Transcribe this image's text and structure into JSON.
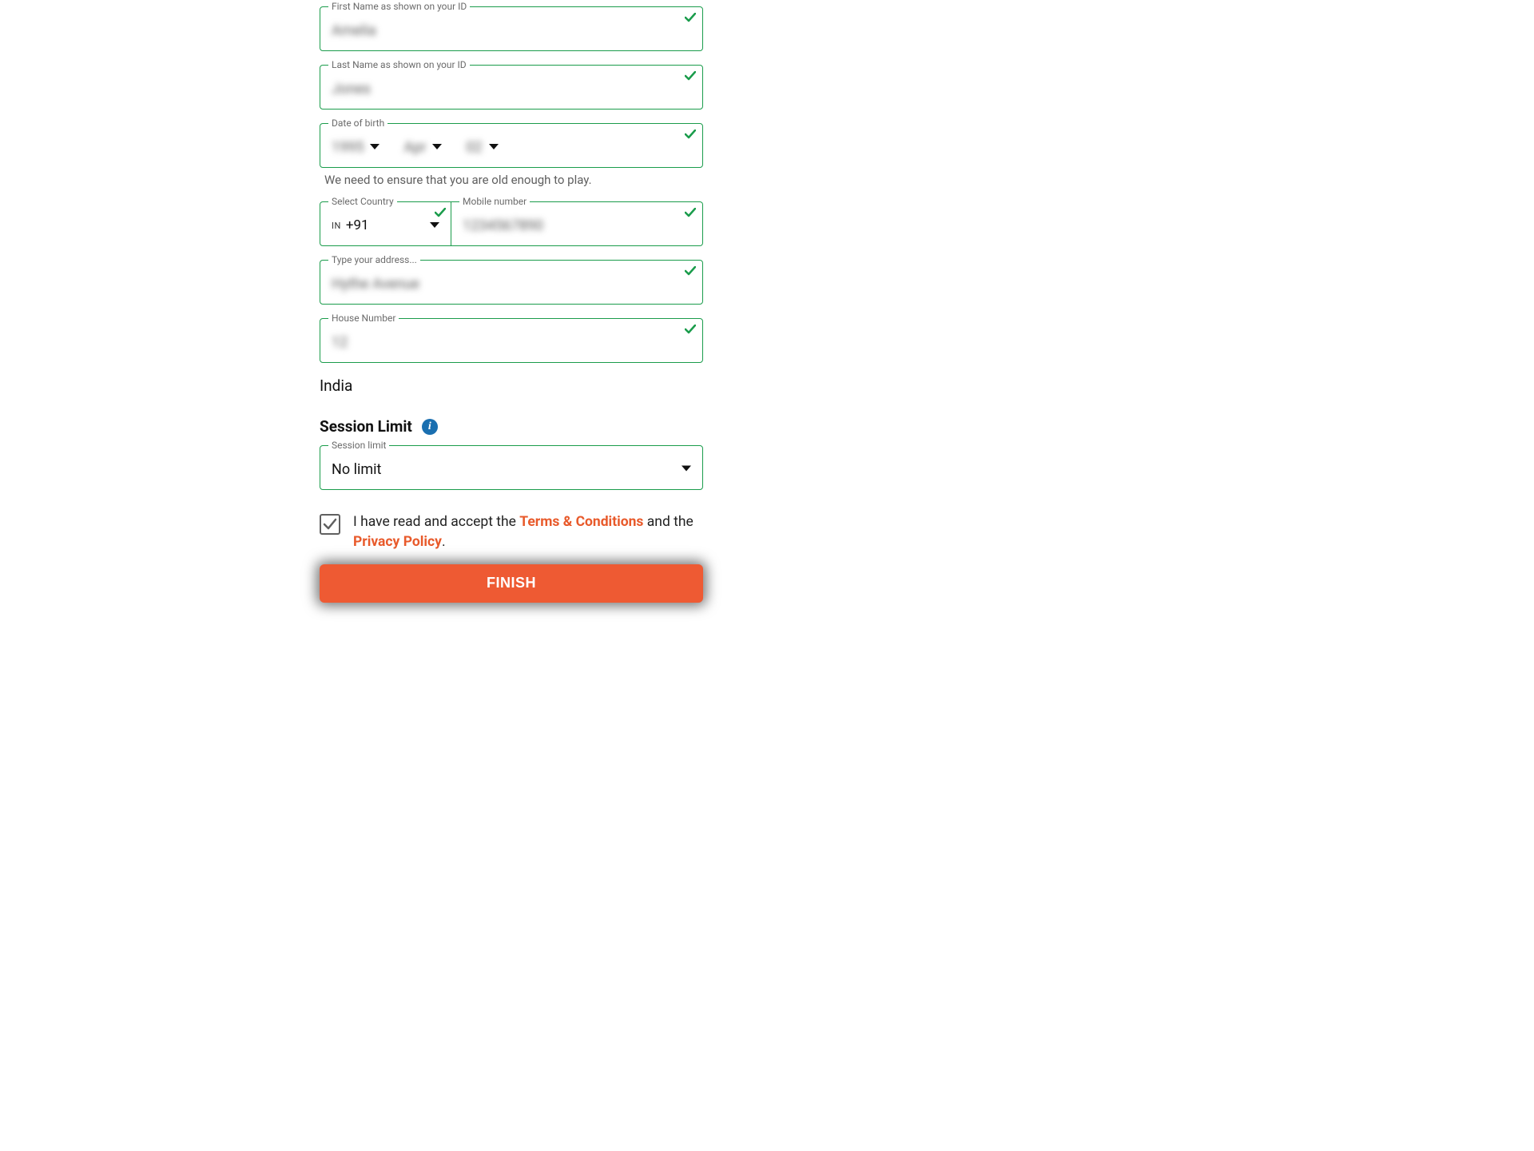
{
  "fields": {
    "first_name": {
      "label": "First Name as shown on your ID",
      "value": "Amelia"
    },
    "last_name": {
      "label": "Last Name as shown on your ID",
      "value": "Jones"
    },
    "dob": {
      "label": "Date of birth",
      "year": "1995",
      "month": "Apr",
      "day": "02",
      "hint": "We need to ensure that you are old enough to play."
    },
    "country": {
      "label": "Select Country",
      "code": "IN",
      "dial": "+91"
    },
    "mobile": {
      "label": "Mobile number",
      "value": "1234567890"
    },
    "address": {
      "label": "Type your address...",
      "value": "Hythe Avenue"
    },
    "house": {
      "label": "House Number",
      "value": "12"
    },
    "country_text": "India"
  },
  "session": {
    "heading": "Session Limit",
    "field_label": "Session limit",
    "value": "No limit"
  },
  "terms": {
    "prefix": "I have read and accept the ",
    "tc": "Terms & Conditions",
    "mid": " and the ",
    "pp": "Privacy Policy",
    "suffix": "."
  },
  "finish_label": "FINISH",
  "colors": {
    "accent_green": "#1a9c4b",
    "accent_orange": "#ee5a33",
    "link_orange": "#e85a2b",
    "info_blue": "#1a6fb0"
  }
}
